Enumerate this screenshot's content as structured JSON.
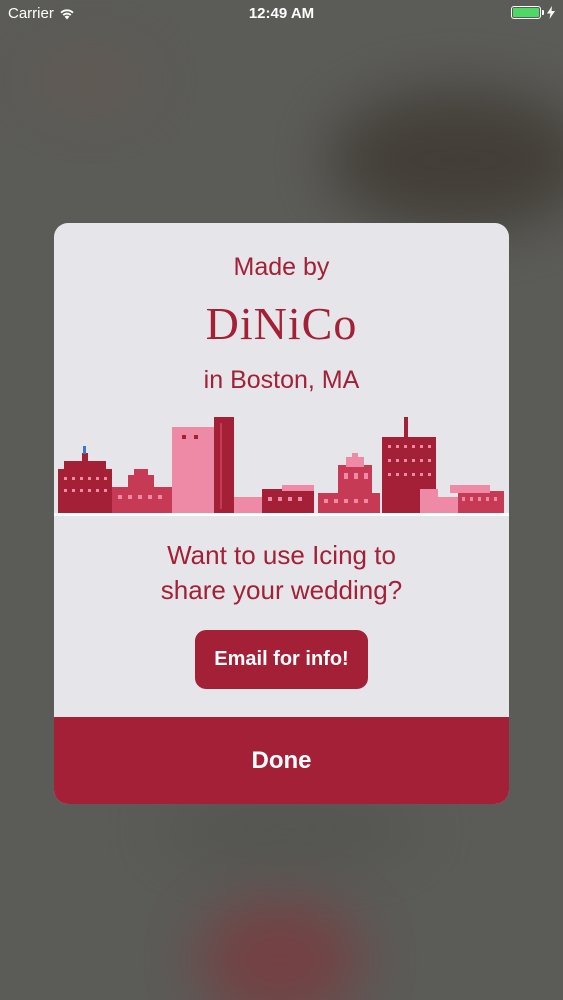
{
  "status_bar": {
    "carrier": "Carrier",
    "time": "12:49 AM",
    "battery_level": 1.0,
    "battery_color": "#4cd964"
  },
  "dialog": {
    "made_by": "Made by",
    "brand": "DiNiCo",
    "location": "in Boston, MA",
    "question_line1": "Want to use Icing to",
    "question_line2": "share your wedding?",
    "email_button_label": "Email for info!",
    "done_button_label": "Done"
  },
  "colors": {
    "accent": "#a32037",
    "dialog_background": "#e6e6ea",
    "skyline_light": "#ef8aa6",
    "skyline_dark": "#a32037"
  },
  "icons": [
    "wifi-icon",
    "battery-icon",
    "charging-bolt-icon",
    "boston-skyline-illustration"
  ]
}
